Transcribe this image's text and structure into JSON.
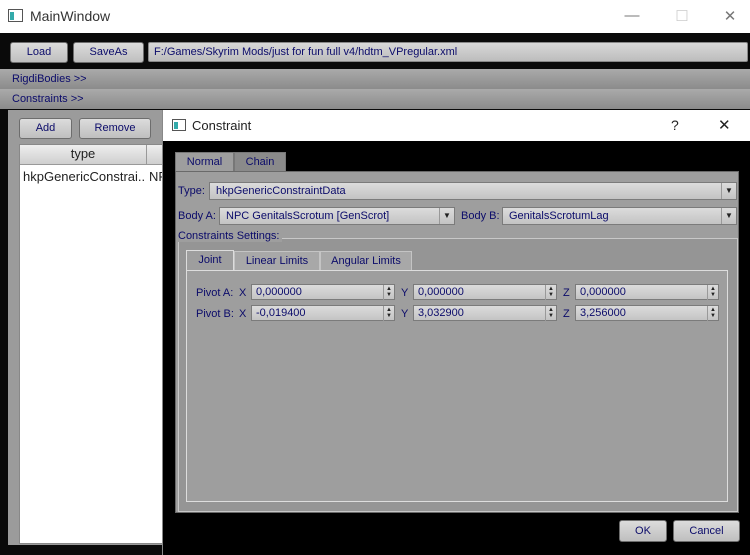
{
  "main_window": {
    "title": "MainWindow",
    "controls": {
      "minimize": "—",
      "maximize": "☐",
      "close": "✕"
    },
    "toolbar": {
      "load_label": "Load",
      "saveas_label": "SaveAs",
      "path": "F:/Games/Skyrim Mods/just for fun full v4/hdtm_VPregular.xml"
    },
    "sections": {
      "rigid_bodies": "RigdiBodies >>",
      "constraints": "Constraints >>"
    },
    "constraints_panel": {
      "add_label": "Add",
      "remove_label": "Remove",
      "table": {
        "header": "type",
        "rows": [
          {
            "type": "hkpGenericConstrai...",
            "next": "NP"
          }
        ]
      }
    }
  },
  "dialog": {
    "title": "Constraint",
    "help": "?",
    "close": "✕",
    "tabs": [
      "Normal",
      "Chain"
    ],
    "type_label": "Type:",
    "type_value": "hkpGenericConstraintData",
    "body_a_label": "Body A:",
    "body_a_value": "NPC GenitalsScrotum [GenScrot]",
    "body_b_label": "Body B:",
    "body_b_value": "GenitalsScrotumLag",
    "settings_label": "Constraints Settings:",
    "settings_tabs": [
      "Joint",
      "Linear Limits",
      "Angular Limits"
    ],
    "pivot_a": {
      "label": "Pivot A:",
      "x": "0,000000",
      "y": "0,000000",
      "z": "0,000000"
    },
    "pivot_b": {
      "label": "Pivot B:",
      "x": "-0,019400",
      "y": "3,032900",
      "z": "3,256000"
    },
    "axis_labels": {
      "x": "X",
      "y": "Y",
      "z": "Z"
    },
    "ok_label": "OK",
    "cancel_label": "Cancel"
  },
  "colors": {
    "text": "#0b0b6a",
    "panel": "#9e9e9e",
    "background": "#000000"
  }
}
